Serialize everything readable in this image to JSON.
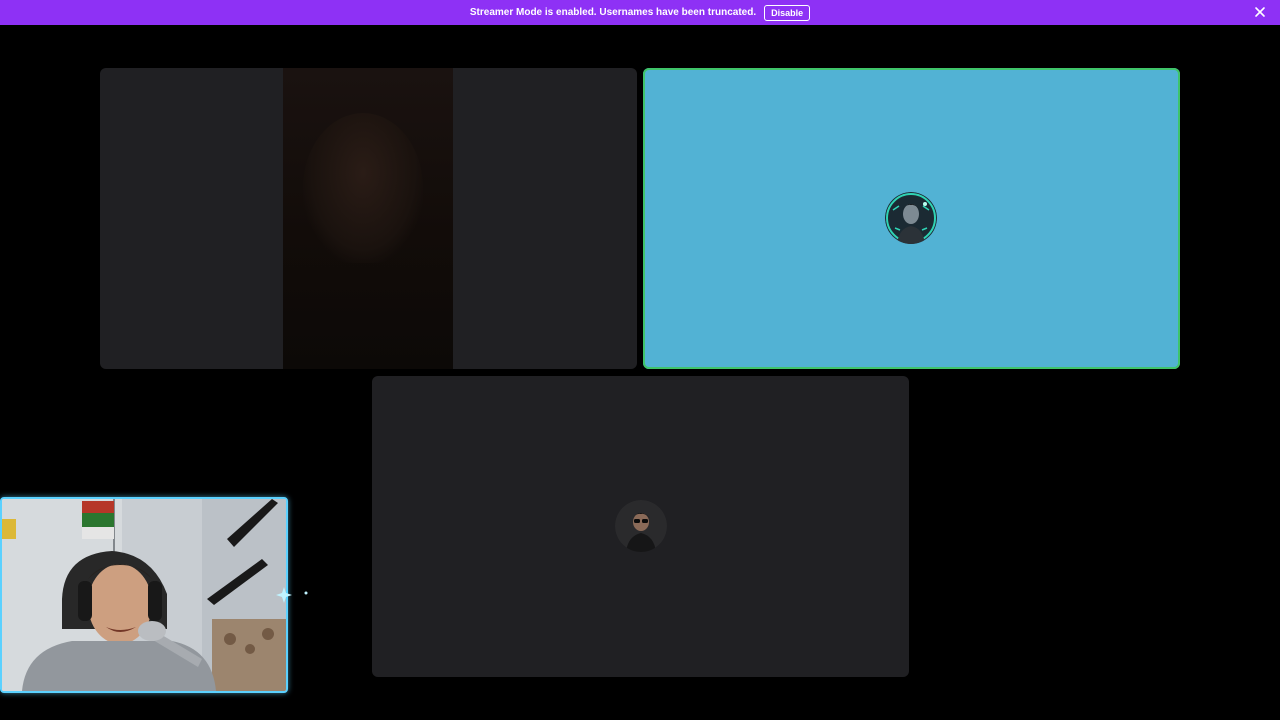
{
  "banner": {
    "message": "Streamer Mode is enabled. Usernames have been truncated.",
    "disable_label": "Disable",
    "background": "#8e31f5"
  },
  "tiles": [
    {
      "kind": "camera-video",
      "speaking": false
    },
    {
      "kind": "avatar",
      "background": "#52b2d4",
      "speaking": true,
      "speaking_ring": "#3fc46a"
    },
    {
      "kind": "avatar",
      "background": "#202023",
      "speaking": false
    }
  ],
  "webcam_overlay": {
    "border_color": "#5bd1ff"
  },
  "icons": [
    "close-icon",
    "sparkle-icon"
  ]
}
